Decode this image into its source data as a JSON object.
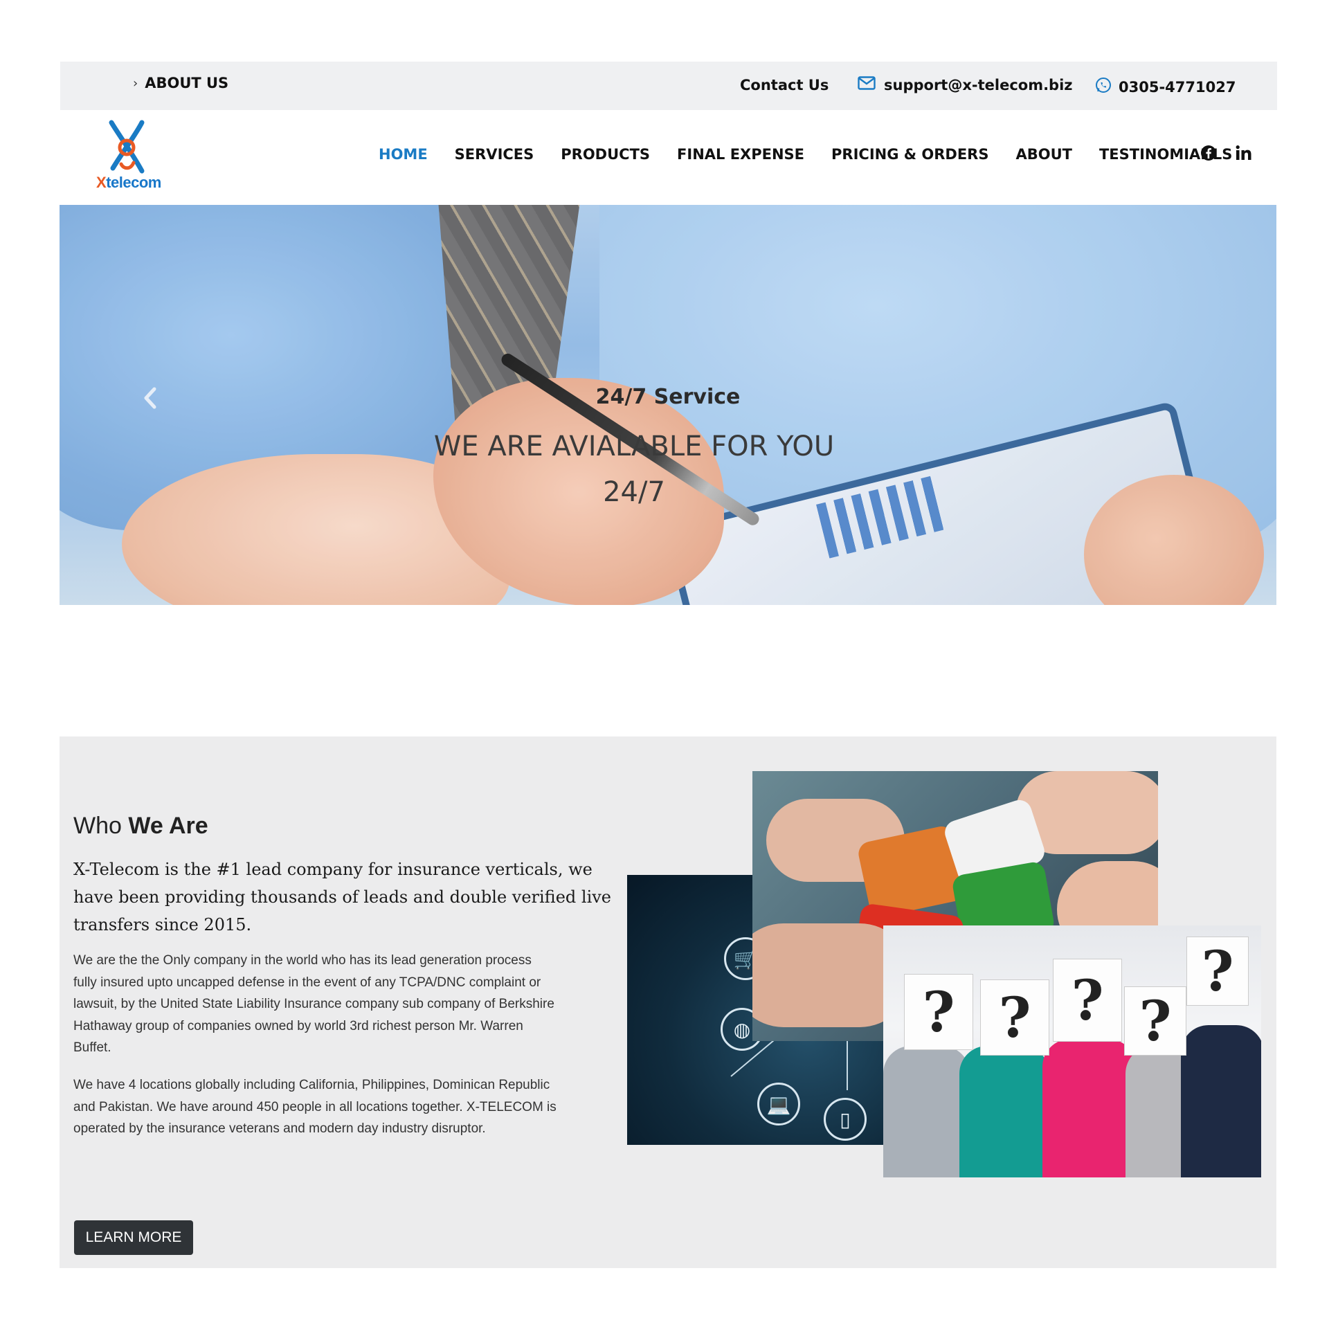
{
  "topbar": {
    "about_label": "ABOUT US",
    "contact_label": "Contact Us",
    "email": "support@x-telecom.biz",
    "phone": "0305-4771027"
  },
  "brand": {
    "logo_text_x": "X",
    "logo_text_rest": "telecom",
    "accent_color": "#1a7bc4",
    "logo_orange": "#e85a24"
  },
  "nav": {
    "items": [
      {
        "label": "HOME",
        "active": true
      },
      {
        "label": "SERVICES",
        "active": false
      },
      {
        "label": "PRODUCTS",
        "active": false
      },
      {
        "label": "FINAL EXPENSE",
        "active": false
      },
      {
        "label": "PRICING & ORDERS",
        "active": false
      },
      {
        "label": "ABOUT",
        "active": false
      },
      {
        "label": "TESTINOMIANLS",
        "active": false
      }
    ],
    "social": [
      "facebook-icon",
      "linkedin-icon"
    ]
  },
  "hero": {
    "eyebrow": "24/7 Service",
    "title": "WE ARE AVIALABLE FOR YOU 24/7",
    "prev_icon": "chevron-left-icon"
  },
  "about": {
    "heading_light": "Who",
    "heading_bold": "We Are",
    "lead": "X-Telecom is the #1 lead company for insurance verticals, we have been providing thousands of leads and double verified live transfers since 2015.",
    "paragraph1": "We are the the Only company in the world who has its lead generation process fully insured upto uncapped defense in the event of any TCPA/DNC complaint or lawsuit, by the United State Liability Insurance company sub company of Berkshire Hathaway group of companies owned by world 3rd richest person Mr. Warren Buffet.",
    "paragraph2": "We have 4 locations globally including California, Philippines, Dominican Republic and Pakistan. We have around 450 people in all locations together. X-TELECOM is operated by the insurance veterans and modern day industry disruptor.",
    "button_label": "LEARN MORE",
    "question_mark": "?"
  }
}
